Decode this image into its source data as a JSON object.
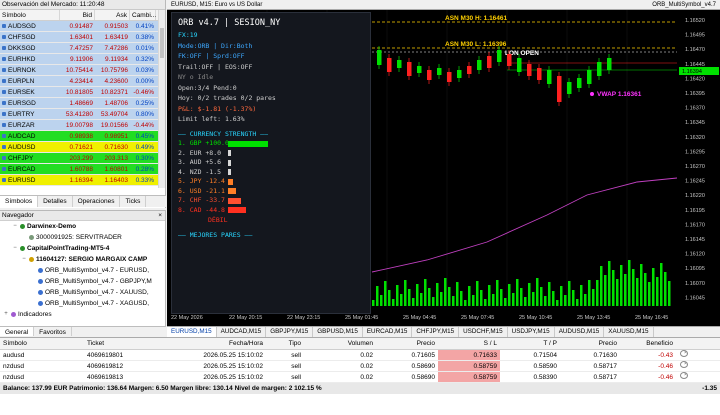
{
  "market_watch": {
    "title": "Observación del Mercado: 11:20:48",
    "headers": [
      "Símbolo",
      "Bid",
      "Ask",
      "Cambi..."
    ],
    "rows": [
      {
        "symbol": "AUDSGD",
        "bid": "0.91487",
        "ask": "0.91503",
        "chg": "0.41%",
        "color": "#bcd3ee"
      },
      {
        "symbol": "CHFSGD",
        "bid": "1.63401",
        "ask": "1.63419",
        "chg": "0.38%",
        "color": "#bcd3ee"
      },
      {
        "symbol": "DKKSGD",
        "bid": "7.47257",
        "ask": "7.47286",
        "chg": "0.01%",
        "color": "#bcd3ee"
      },
      {
        "symbol": "EURHKD",
        "bid": "9.11906",
        "ask": "9.11934",
        "chg": "0.32%",
        "color": "#bcd3ee"
      },
      {
        "symbol": "EURNOK",
        "bid": "10.75414",
        "ask": "10.75796",
        "chg": "0.03%",
        "color": "#bcd3ee"
      },
      {
        "symbol": "EURPLN",
        "bid": "4.23414",
        "ask": "4.23600",
        "chg": "0.00%",
        "color": "#bcd3ee"
      },
      {
        "symbol": "EURSEK",
        "bid": "10.81805",
        "ask": "10.82371",
        "chg": "-0.46%",
        "color": "#bcd3ee"
      },
      {
        "symbol": "EURSGD",
        "bid": "1.48669",
        "ask": "1.48706",
        "chg": "0.25%",
        "color": "#bcd3ee"
      },
      {
        "symbol": "EURTRY",
        "bid": "53.41280",
        "ask": "53.49704",
        "chg": "0.80%",
        "color": "#bcd3ee"
      },
      {
        "symbol": "EURZAR",
        "bid": "19.00798",
        "ask": "19.01566",
        "chg": "-0.44%",
        "color": "#bcd3ee"
      },
      {
        "symbol": "AUDCAD",
        "bid": "0.98938",
        "ask": "0.98951",
        "chg": "0.45%",
        "color": "#22dd22"
      },
      {
        "symbol": "AUDUSD",
        "bid": "0.71621",
        "ask": "0.71630",
        "chg": "0.49%",
        "color": "#f0f000"
      },
      {
        "symbol": "CHFJPY",
        "bid": "203.299",
        "ask": "203.313",
        "chg": "0.30%",
        "color": "#22dd22"
      },
      {
        "symbol": "EURCAD",
        "bid": "1.60788",
        "ask": "1.60801",
        "chg": "0.28%",
        "color": "#22dd22"
      },
      {
        "symbol": "EURUSD",
        "bid": "1.16394",
        "ask": "1.16403",
        "chg": "0.33%",
        "color": "#f0f000"
      }
    ],
    "tabs": [
      "Símbolos",
      "Detalles",
      "Operaciones",
      "Ticks"
    ]
  },
  "navigator": {
    "title": "Navegador",
    "items": [
      {
        "text": "Darwinex-Demo",
        "indent": 1,
        "expander": "−",
        "icon": "server"
      },
      {
        "text": "3000091925: SERVITRADER",
        "indent": 2,
        "expander": "",
        "icon": "account"
      },
      {
        "text": "CapitalPointTrading-MT5-4",
        "indent": 1,
        "expander": "−",
        "icon": "server"
      },
      {
        "text": "11604127: SERGIO MARGAIX CAMP",
        "indent": 2,
        "expander": "−",
        "icon": "account-active"
      },
      {
        "text": "ORB_MultiSymbol_v4.7 - EURUSD,",
        "indent": 3,
        "expander": "",
        "icon": "ea"
      },
      {
        "text": "ORB_MultiSymbol_v4.7 - GBPJPY,M",
        "indent": 3,
        "expander": "",
        "icon": "ea"
      },
      {
        "text": "ORB_MultiSymbol_v4.7 - XAUUSD,",
        "indent": 3,
        "expander": "",
        "icon": "ea"
      },
      {
        "text": "ORB_MultiSymbol_v4.7 - XAGUSD,",
        "indent": 3,
        "expander": "",
        "icon": "ea"
      },
      {
        "text": "Indicadores",
        "indent": 0,
        "expander": "+",
        "icon": "indicators"
      }
    ],
    "tabs": [
      "General",
      "Favoritos"
    ]
  },
  "chart": {
    "header_left": "EURUSD, M15:  Euro vs US Dollar",
    "header_right": "ORB_MultiSymbol_v4.7",
    "labels": {
      "asn_high": "ASN M30 H: 1.16461",
      "asn_low": "ASN M30 L: 1.16396",
      "lon_open": "LON OPEN",
      "vwap": "VWAP 1.16361"
    },
    "price_axis": [
      "1.16520",
      "1.16495",
      "1.16470",
      "1.16445",
      "1.16420",
      "1.16395",
      "1.16370",
      "1.16345",
      "1.16320",
      "1.16295",
      "1.16270",
      "1.16245",
      "1.16220",
      "1.16195",
      "1.16170",
      "1.16145",
      "1.16120",
      "1.16095",
      "1.16070",
      "1.16045"
    ],
    "current_price": "1.16394",
    "time_axis": [
      "22 May 2026",
      "22 May 20:15",
      "22 May 23:15",
      "25 May 01:45",
      "25 May 04:45",
      "25 May 07:45",
      "25 May 10:45",
      "25 May 13:45",
      "25 May 16:45"
    ],
    "colors": {
      "bull": "#00e000",
      "bear": "#ff2020",
      "vwap": "#ff33ff",
      "ma": "#c040c0",
      "level": "#ffd000",
      "ask_line": "#ff2020",
      "bid_line": "#00e000"
    }
  },
  "panel": {
    "lines": [
      {
        "text": "ORB v4.7 | SESION_NY",
        "color": "#ffffff",
        "big": true
      },
      {
        "text": "FX:19",
        "color": "#29d6ff"
      },
      {
        "text": "Mode:ORB | Dir:Both",
        "color": "#3da8ff"
      },
      {
        "text": "FK:OFF | Sprd:OFF",
        "color": "#3da8ff"
      },
      {
        "text": "Trail:OFF | EOS:OFF",
        "color": "#d0d0d0"
      },
      {
        "text": "NY o Idle",
        "color": "#8a8a8a"
      },
      {
        "text": "Open:3/4  Pend:0",
        "color": "#d0d0d0"
      },
      {
        "text": "Hoy: 0/2 trades  0/2 pares",
        "color": "#d0d0d0"
      },
      {
        "text": "P&L: $-1.81 (-1.37%)",
        "color": "#ff6a3d"
      },
      {
        "text": "Limit left: 1.63%",
        "color": "#d0d0d0"
      }
    ],
    "strength_title": "—— CURRENCY STRENGTH ——",
    "strength": [
      {
        "label": "1. GBP +100.0",
        "value": 100,
        "color": "#00e000",
        "text_color": "#00e000"
      },
      {
        "label": "2. EUR +8.0",
        "value": 8,
        "color": "#d8d8d8",
        "text_color": "#d0d0d0"
      },
      {
        "label": "3. AUD +5.6",
        "value": 5.6,
        "color": "#d8d8d8",
        "text_color": "#d0d0d0"
      },
      {
        "label": "4. NZD -1.5",
        "value": 1.5,
        "color": "#d8d8d8",
        "text_color": "#d0d0d0"
      },
      {
        "label": "5. JPY -12.4",
        "value": 12.4,
        "color": "#ff7f27",
        "text_color": "#ff7f27"
      },
      {
        "label": "6. USD -21.1",
        "value": 21.1,
        "color": "#ff7f27",
        "text_color": "#ff7f27"
      },
      {
        "label": "7. CHF -33.7",
        "value": 33.7,
        "color": "#ff5030",
        "text_color": "#ff5030"
      },
      {
        "label": "8. CAD -44.8",
        "value": 44.8,
        "color": "#ff3020",
        "text_color": "#ff3020"
      }
    ],
    "weak_label": "DÉBIL",
    "best_pairs_title": "—— MEJORES PARES ——"
  },
  "chart_tabs": [
    "EURUSD,M15",
    "AUDCAD,M15",
    "GBPJPY,M15",
    "GBPUSD,M15",
    "EURCAD,M15",
    "CHFJPY,M15",
    "USDCHF,M15",
    "USDJPY,M15",
    "AUDUSD,M15",
    "XAUUSD,M15"
  ],
  "terminal": {
    "headers": [
      "Símbolo",
      "Ticket",
      "Fecha/Hora",
      "Tipo",
      "Volumen",
      "Precio",
      "S / L",
      "T / P",
      "Precio",
      "Beneficio"
    ],
    "rows": [
      {
        "symbol": "audusd",
        "ticket": "4069619801",
        "time": "2026.05.25 15:10:02",
        "type": "sell",
        "volume": "0.02",
        "price": "0.71605",
        "sl": "0.71633",
        "tp": "0.71504",
        "cur": "0.71630",
        "profit": "-0.43"
      },
      {
        "symbol": "nzdusd",
        "ticket": "4069619812",
        "time": "2026.05.25 15:10:02",
        "type": "sell",
        "volume": "0.02",
        "price": "0.58690",
        "sl": "0.58759",
        "tp": "0.58590",
        "cur": "0.58717",
        "profit": "-0.46"
      },
      {
        "symbol": "nzdusd",
        "ticket": "4069619813",
        "time": "2026.05.25 15:10:02",
        "type": "sell",
        "volume": "0.02",
        "price": "0.58690",
        "sl": "0.58759",
        "tp": "0.58390",
        "cur": "0.58717",
        "profit": "-0.46"
      }
    ],
    "balance_text": "Balance: 137.99 EUR  Patrimonio: 136.64  Margen: 6.50  Margen libre: 130.14  Nivel de margen: 2 102.15 %",
    "total_profit": "-1.35"
  }
}
